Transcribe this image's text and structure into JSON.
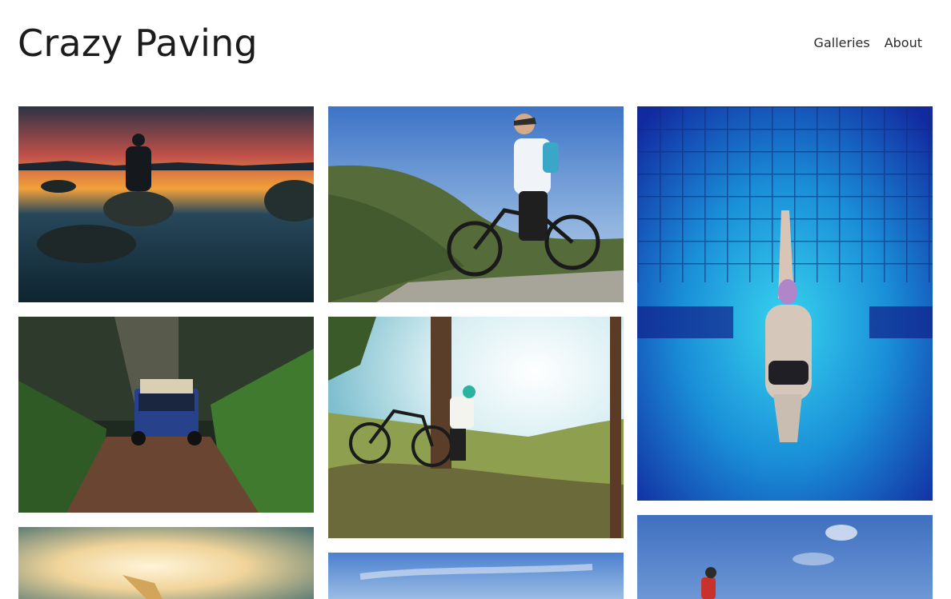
{
  "site": {
    "title": "Crazy Paving"
  },
  "nav": {
    "items": [
      {
        "label": "Galleries"
      },
      {
        "label": "About"
      }
    ]
  },
  "gallery": {
    "photos": [
      {
        "subject": "person sitting on rock at sunset lake"
      },
      {
        "subject": "cyclist on mountain ridge"
      },
      {
        "subject": "swimmer underwater in blue pool"
      },
      {
        "subject": "blue off-road vehicle on forest trail"
      },
      {
        "subject": "person with bicycle by tree on hillside"
      },
      {
        "subject": "person reaching into sunlit sky"
      },
      {
        "subject": "blue sky landscape"
      },
      {
        "subject": "climber in red jacket against blue sky"
      }
    ]
  }
}
